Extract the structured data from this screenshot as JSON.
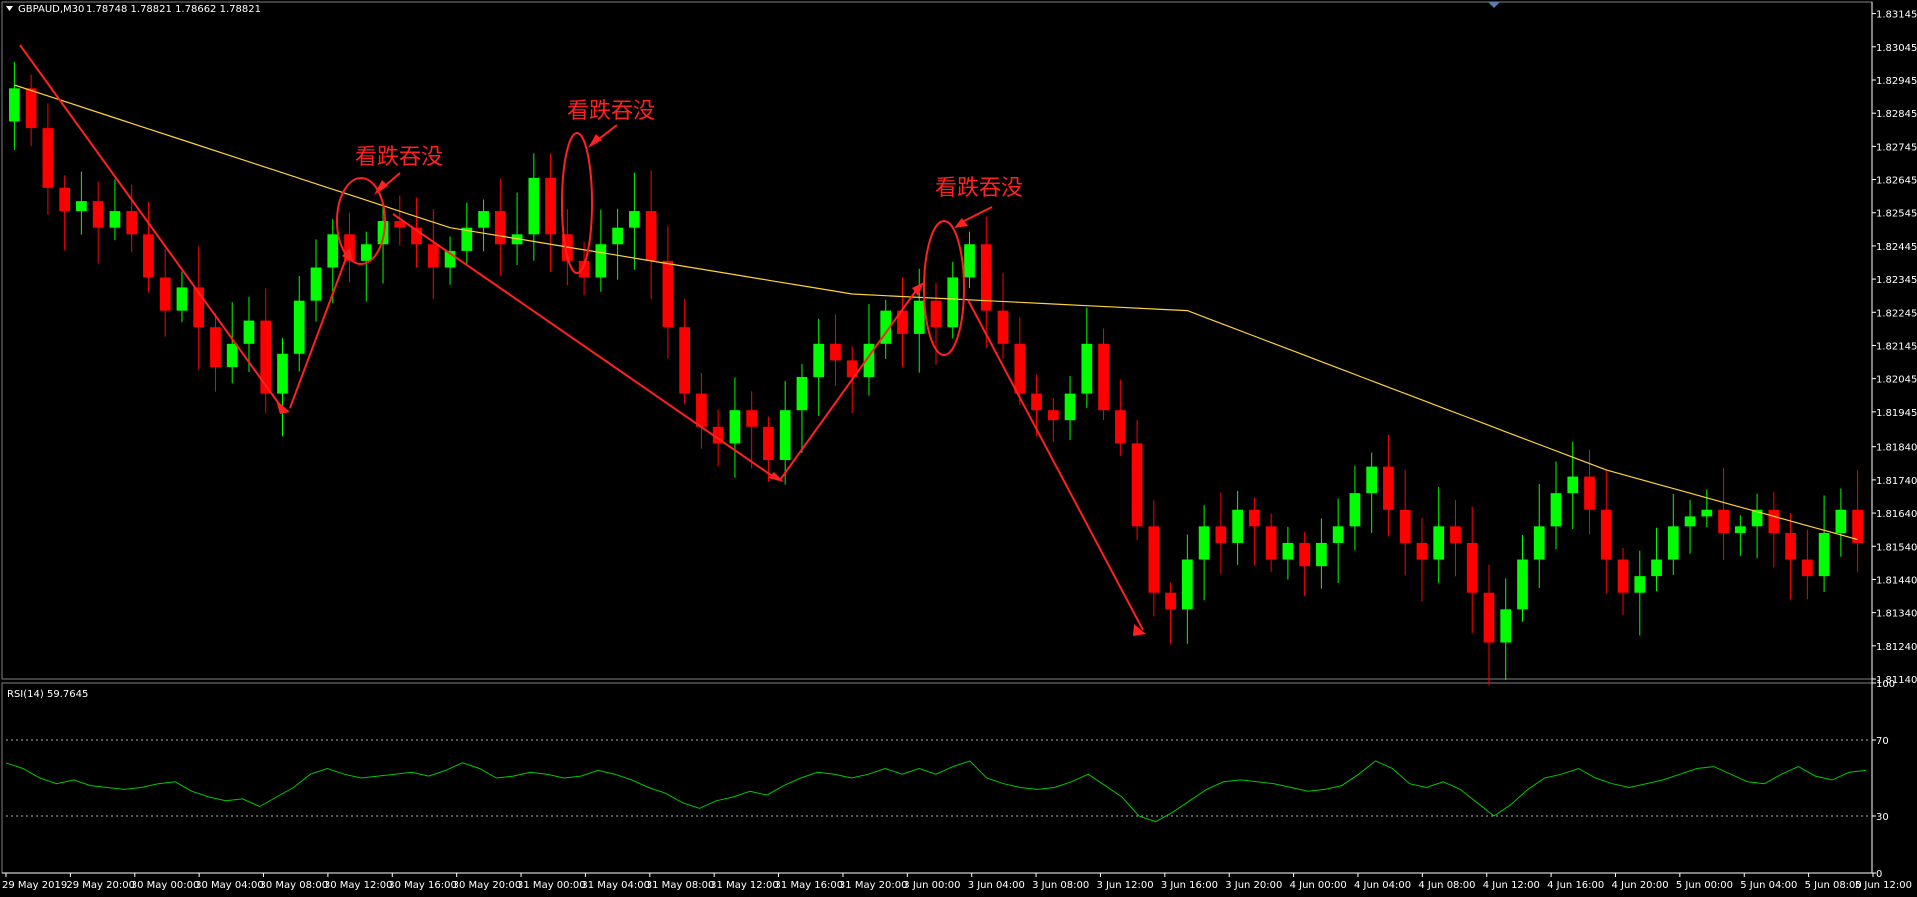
{
  "header": {
    "symbol": "GBPAUD,M30",
    "ohlc": "1.78748 1.78821 1.78662 1.78821"
  },
  "rsi_header": "RSI(14) 59.7645",
  "colors": {
    "background": "#000000",
    "bull": "#00ff00",
    "bear": "#ff0000",
    "ma": "#ffd23a",
    "rsi": "#00c800",
    "axis": "#ffffff",
    "annotation": "#ff2020"
  },
  "annotations": [
    {
      "text": "看跌吞没",
      "at_time": "30 May 13:00",
      "near_price": 1.826
    },
    {
      "text": "看跌吞没",
      "at_time": "31 May 00:30",
      "near_price": 1.8276
    },
    {
      "text": "看跌吞没",
      "at_time": "3 Jun 01:00",
      "near_price": 1.8243
    }
  ],
  "chart_data": [
    {
      "type": "candlestick",
      "ylim": [
        1.8114,
        1.8318
      ],
      "yticks": [
        "1.83145",
        "1.83045",
        "1.82945",
        "1.82845",
        "1.82745",
        "1.82645",
        "1.82545",
        "1.82445",
        "1.82345",
        "1.82245",
        "1.82145",
        "1.82045",
        "1.81945",
        "1.81840",
        "1.81740",
        "1.81640",
        "1.81540",
        "1.81440",
        "1.81340",
        "1.81240",
        "1.81140"
      ],
      "xticks": [
        "29 May 2019",
        "29 May 20:00",
        "30 May 00:00",
        "30 May 04:00",
        "30 May 08:00",
        "30 May 12:00",
        "30 May 16:00",
        "30 May 20:00",
        "31 May 00:00",
        "31 May 04:00",
        "31 May 08:00",
        "31 May 12:00",
        "31 May 16:00",
        "31 May 20:00",
        "3 Jun 00:00",
        "3 Jun 04:00",
        "3 Jun 08:00",
        "3 Jun 12:00",
        "3 Jun 16:00",
        "3 Jun 20:00",
        "4 Jun 00:00",
        "4 Jun 04:00",
        "4 Jun 08:00",
        "4 Jun 12:00",
        "4 Jun 16:00",
        "4 Jun 20:00",
        "5 Jun 00:00",
        "5 Jun 04:00",
        "5 Jun 08:00",
        "5 Jun 12:00"
      ],
      "series_close": [
        1.8292,
        1.828,
        1.8262,
        1.8255,
        1.8258,
        1.825,
        1.8255,
        1.8248,
        1.8235,
        1.8225,
        1.8232,
        1.822,
        1.8208,
        1.8215,
        1.8222,
        1.82,
        1.8212,
        1.8228,
        1.8238,
        1.8248,
        1.824,
        1.8245,
        1.8252,
        1.825,
        1.8245,
        1.8238,
        1.8243,
        1.825,
        1.8255,
        1.8245,
        1.8248,
        1.8265,
        1.8248,
        1.824,
        1.8235,
        1.8245,
        1.825,
        1.8255,
        1.824,
        1.822,
        1.82,
        1.819,
        1.8185,
        1.8195,
        1.819,
        1.818,
        1.8195,
        1.8205,
        1.8215,
        1.821,
        1.8205,
        1.8215,
        1.8225,
        1.8218,
        1.8228,
        1.822,
        1.8235,
        1.8245,
        1.8225,
        1.8215,
        1.82,
        1.8195,
        1.8192,
        1.82,
        1.8215,
        1.8195,
        1.8185,
        1.816,
        1.814,
        1.8135,
        1.815,
        1.816,
        1.8155,
        1.8165,
        1.816,
        1.815,
        1.8155,
        1.8148,
        1.8155,
        1.816,
        1.817,
        1.8178,
        1.8165,
        1.8155,
        1.815,
        1.816,
        1.8155,
        1.814,
        1.8125,
        1.8135,
        1.815,
        1.816,
        1.817,
        1.8175,
        1.8165,
        1.815,
        1.814,
        1.8145,
        1.815,
        1.816,
        1.8163,
        1.8165,
        1.8158,
        1.816,
        1.8165,
        1.8158,
        1.815,
        1.8145,
        1.8158,
        1.8165,
        1.8155
      ],
      "ma_end_points": [
        [
          0,
          1.8293
        ],
        [
          26,
          1.825
        ],
        [
          50,
          1.823
        ],
        [
          70,
          1.8225
        ],
        [
          83,
          1.82
        ],
        [
          95,
          1.8177
        ],
        [
          110,
          1.8156
        ]
      ]
    },
    {
      "type": "line",
      "title": "RSI(14)",
      "ylim": [
        0,
        100
      ],
      "yticks": [
        "100",
        "70",
        "30",
        "0"
      ],
      "levels": [
        70,
        30
      ],
      "values": [
        58,
        55,
        50,
        47,
        49,
        46,
        45,
        44,
        45,
        47,
        48,
        43,
        40,
        38,
        39,
        35,
        40,
        45,
        52,
        55,
        52,
        50,
        51,
        52,
        53,
        51,
        54,
        58,
        55,
        50,
        51,
        53,
        52,
        50,
        51,
        54,
        52,
        49,
        45,
        42,
        37,
        34,
        38,
        40,
        43,
        41,
        46,
        50,
        53,
        52,
        50,
        52,
        55,
        52,
        55,
        52,
        56,
        59,
        50,
        47,
        45,
        44,
        45,
        48,
        52,
        46,
        40,
        30,
        27,
        32,
        38,
        44,
        48,
        49,
        48,
        47,
        45,
        43,
        44,
        46,
        52,
        59,
        55,
        47,
        45,
        48,
        44,
        37,
        30,
        36,
        44,
        50,
        52,
        55,
        50,
        47,
        45,
        47,
        49,
        52,
        55,
        56,
        52,
        48,
        47,
        52,
        56,
        51,
        49,
        53,
        54
      ]
    }
  ]
}
